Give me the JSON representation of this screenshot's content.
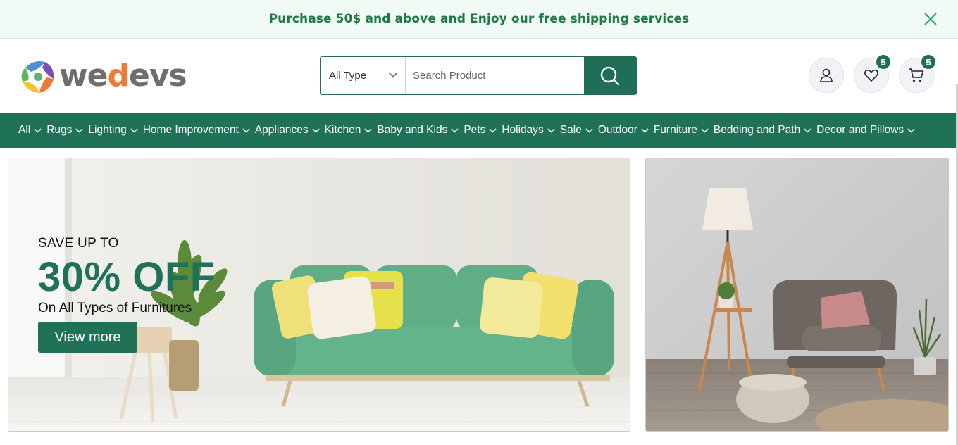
{
  "promo": {
    "text": "Purchase 50$ and above and Enjoy our free shipping services"
  },
  "logo": {
    "text_main": "we",
    "text_accent": "d",
    "text_end": "evs"
  },
  "search": {
    "type_label": "All Type",
    "placeholder": "Search Product"
  },
  "header_icons": {
    "wishlist_count": "5",
    "cart_count": "5"
  },
  "nav": {
    "items": [
      {
        "label": "All"
      },
      {
        "label": "Rugs"
      },
      {
        "label": "Lighting"
      },
      {
        "label": "Home Improvement"
      },
      {
        "label": "Appliances"
      },
      {
        "label": "Kitchen"
      },
      {
        "label": "Baby and Kids"
      },
      {
        "label": "Pets"
      },
      {
        "label": "Holidays"
      },
      {
        "label": "Sale"
      },
      {
        "label": "Outdoor"
      },
      {
        "label": "Furniture"
      },
      {
        "label": "Bedding and Path"
      },
      {
        "label": "Decor and Pillows"
      }
    ]
  },
  "hero": {
    "subtitle": "SAVE UP TO",
    "headline": "30% OFF",
    "line": "On All Types of Furnitures",
    "button": "View more"
  },
  "colors": {
    "brand": "#1f7258",
    "promo_bg": "#f1faf4",
    "promo_text": "#1e7a45",
    "accent": "#f07a35"
  }
}
